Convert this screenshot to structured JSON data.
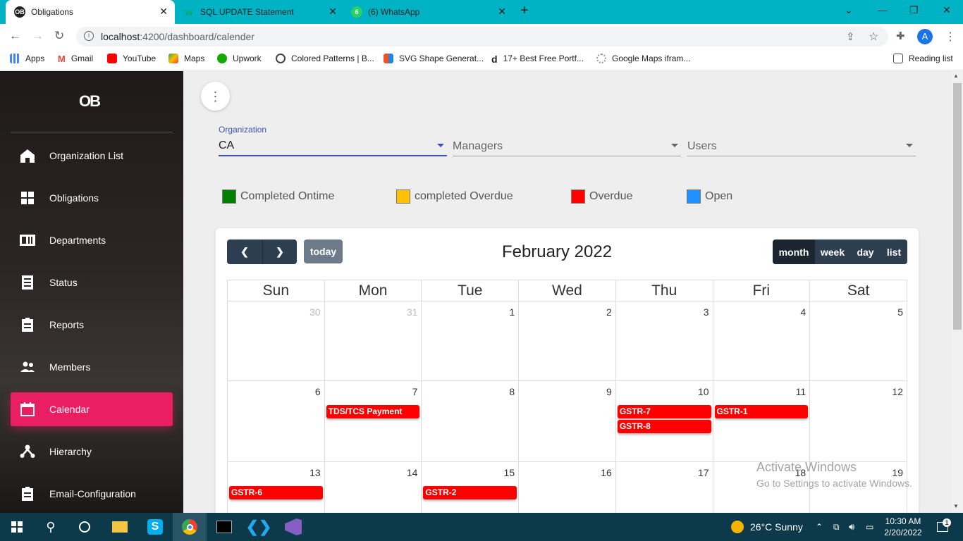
{
  "browser": {
    "tabs": [
      {
        "title": "Obligations",
        "active": true
      },
      {
        "title": "SQL UPDATE Statement",
        "active": false
      },
      {
        "title": "(6) WhatsApp",
        "active": false
      }
    ],
    "new_tab": "+",
    "url_host": "localhost",
    "url_rest": ":4200/dashboard/calender",
    "profile_initial": "A",
    "bookmarks": [
      "Apps",
      "Gmail",
      "YouTube",
      "Maps",
      "Upwork",
      "Colored Patterns | B...",
      "SVG Shape Generat...",
      "17+ Best Free Portf...",
      "Google Maps ifram..."
    ],
    "reading_list": "Reading list"
  },
  "sidebar": {
    "logo": "OB",
    "items": [
      {
        "label": "Organization List",
        "icon": "home-icon"
      },
      {
        "label": "Obligations",
        "icon": "grid-icon"
      },
      {
        "label": "Departments",
        "icon": "id-card-icon"
      },
      {
        "label": "Status",
        "icon": "receipt-icon"
      },
      {
        "label": "Reports",
        "icon": "clipboard-icon"
      },
      {
        "label": "Members",
        "icon": "people-icon"
      },
      {
        "label": "Calendar",
        "icon": "calendar-icon",
        "active": true
      },
      {
        "label": "Hierarchy",
        "icon": "hierarchy-icon"
      },
      {
        "label": "Email-Configuration",
        "icon": "clipboard-icon"
      }
    ]
  },
  "filters": {
    "organization_label": "Organization",
    "organization_value": "CA",
    "managers_placeholder": "Managers",
    "users_placeholder": "Users"
  },
  "legend": [
    {
      "label": "Completed Ontime",
      "color": "#008000"
    },
    {
      "label": "completed Overdue",
      "color": "#ffc107"
    },
    {
      "label": "Overdue",
      "color": "#ff0000"
    },
    {
      "label": "Open",
      "color": "#1e90ff"
    }
  ],
  "calendar": {
    "title": "February 2022",
    "today_label": "today",
    "views": [
      "month",
      "week",
      "day",
      "list"
    ],
    "active_view": "month",
    "weekdays": [
      "Sun",
      "Mon",
      "Tue",
      "Wed",
      "Thu",
      "Fri",
      "Sat"
    ],
    "weeks": [
      [
        {
          "d": "30",
          "o": true
        },
        {
          "d": "31",
          "o": true
        },
        {
          "d": "1"
        },
        {
          "d": "2"
        },
        {
          "d": "3"
        },
        {
          "d": "4"
        },
        {
          "d": "5"
        }
      ],
      [
        {
          "d": "6"
        },
        {
          "d": "7",
          "ev": [
            "TDS/TCS Payment"
          ]
        },
        {
          "d": "8"
        },
        {
          "d": "9"
        },
        {
          "d": "10",
          "ev": [
            "GSTR-7",
            "GSTR-8"
          ]
        },
        {
          "d": "11",
          "ev": [
            "GSTR-1"
          ]
        },
        {
          "d": "12"
        }
      ],
      [
        {
          "d": "13",
          "ev": [
            "GSTR-6"
          ]
        },
        {
          "d": "14"
        },
        {
          "d": "15",
          "ev": [
            "GSTR-2"
          ]
        },
        {
          "d": "16"
        },
        {
          "d": "17"
        },
        {
          "d": "18"
        },
        {
          "d": "19"
        }
      ]
    ],
    "event_color": "#ff0000"
  },
  "watermark": {
    "line1": "Activate Windows",
    "line2": "Go to Settings to activate Windows."
  },
  "taskbar": {
    "weather": "26°C  Sunny",
    "time": "10:30 AM",
    "date": "2/20/2022",
    "notification_count": "1"
  }
}
